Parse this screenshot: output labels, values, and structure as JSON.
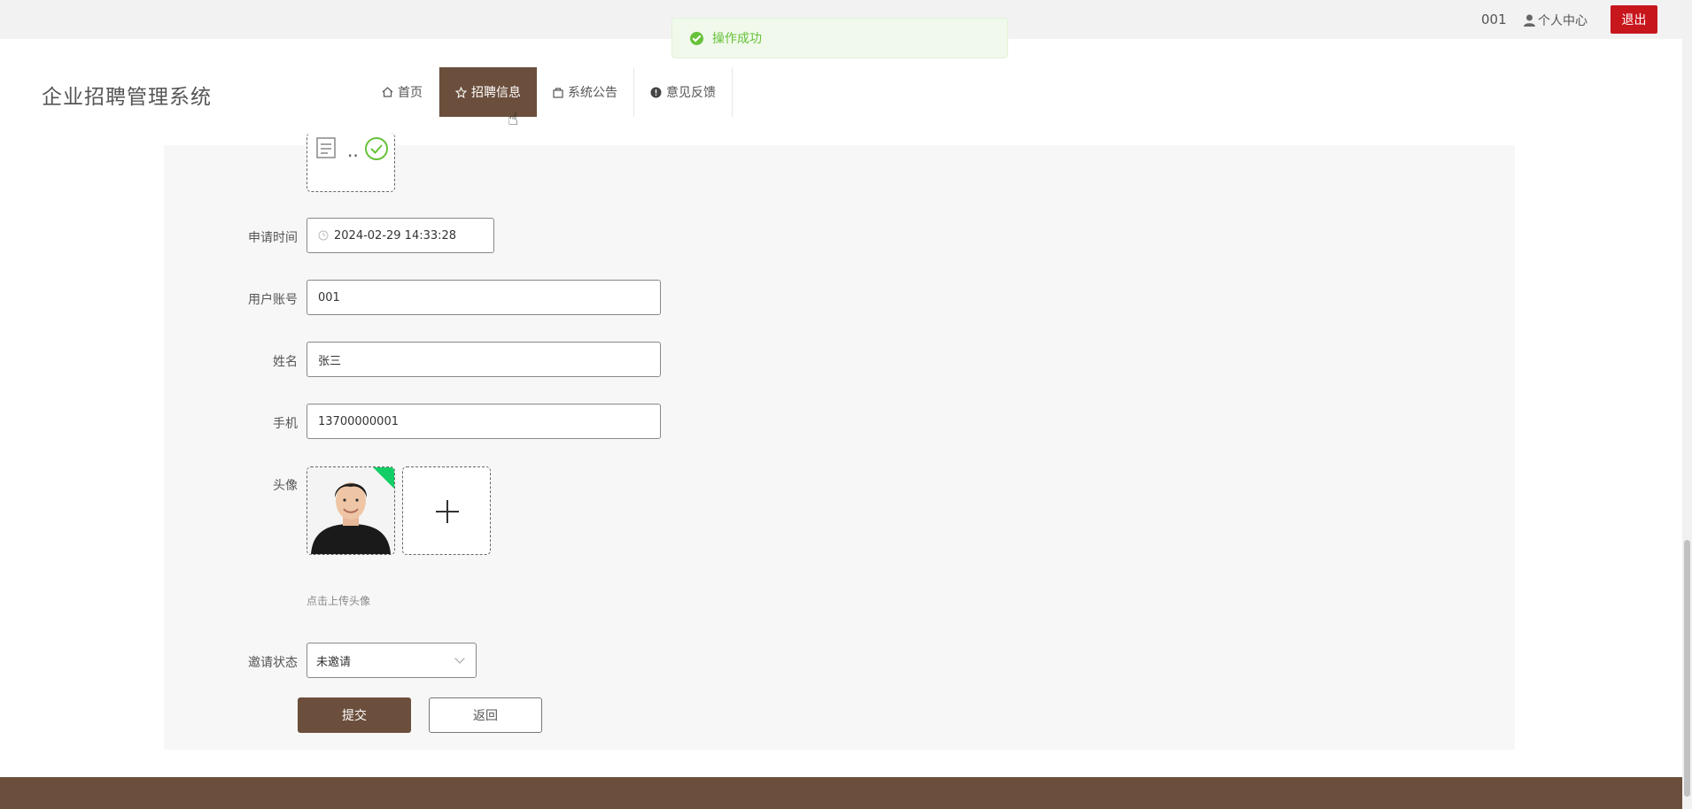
{
  "topbar": {
    "account": "001",
    "user_center": "个人中心",
    "logout": "退出"
  },
  "toast": {
    "message": "操作成功",
    "color": "#67c23a"
  },
  "header": {
    "brand": "企业招聘管理系统",
    "nav": [
      {
        "icon": "home-icon",
        "label": "首页",
        "active": false
      },
      {
        "icon": "star-icon",
        "label": "招聘信息",
        "active": true
      },
      {
        "icon": "bag-icon",
        "label": "系统公告",
        "active": false
      },
      {
        "icon": "alert-icon",
        "label": "意见反馈",
        "active": false
      }
    ]
  },
  "form": {
    "apply_time": {
      "label": "申请时间",
      "value": "2024-02-29 14:33:28"
    },
    "account": {
      "label": "用户账号",
      "value": "001"
    },
    "name": {
      "label": "姓名",
      "value": "张三"
    },
    "phone": {
      "label": "手机",
      "value": "13700000001"
    },
    "avatar": {
      "label": "头像",
      "hint": "点击上传头像"
    },
    "invite_status": {
      "label": "邀请状态",
      "value": "未邀请"
    },
    "submit": "提交",
    "back": "返回"
  },
  "colors": {
    "primary": "#6b4f3c",
    "danger": "#c8161d"
  }
}
